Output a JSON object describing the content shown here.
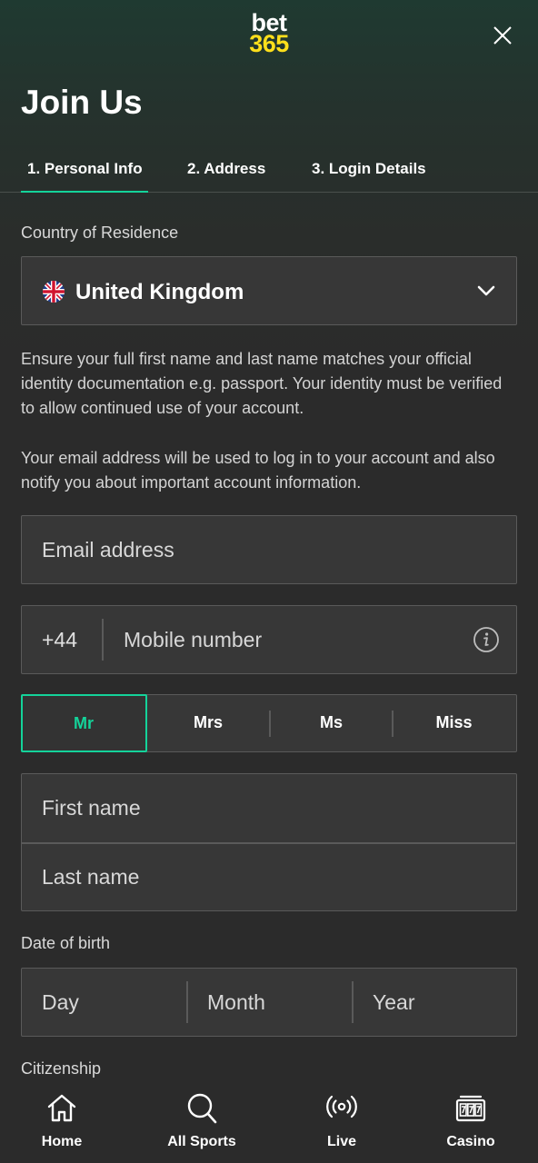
{
  "header": {
    "logo_line1": "bet",
    "logo_line2": "365",
    "title": "Join Us"
  },
  "tabs": [
    {
      "label": "1.  Personal Info",
      "active": true
    },
    {
      "label": "2.  Address",
      "active": false
    },
    {
      "label": "3.  Login Details",
      "active": false
    }
  ],
  "country": {
    "label": "Country of Residence",
    "value": "United Kingdom",
    "flag_icon": "uk-flag-icon"
  },
  "info": {
    "name_notice": "Ensure your full first name and last name matches your official identity documentation e.g. passport. Your identity must be verified to allow continued use of your account.",
    "email_notice": "Your email address will be used to log in to your account and also notify you about important account information."
  },
  "email": {
    "placeholder": "Email address"
  },
  "phone": {
    "prefix": "+44",
    "placeholder": "Mobile number"
  },
  "titles": {
    "options": [
      "Mr",
      "Mrs",
      "Ms",
      "Miss"
    ],
    "selected": "Mr"
  },
  "names": {
    "first_placeholder": "First name",
    "last_placeholder": "Last name"
  },
  "dob": {
    "label": "Date of birth",
    "day": "Day",
    "month": "Month",
    "year": "Year"
  },
  "citizenship": {
    "label": "Citizenship"
  },
  "bottom_nav": [
    {
      "label": "Home",
      "icon": "home-icon"
    },
    {
      "label": "All Sports",
      "icon": "search-icon"
    },
    {
      "label": "Live",
      "icon": "live-broadcast-icon"
    },
    {
      "label": "Casino",
      "icon": "slot-machine-icon"
    }
  ],
  "colors": {
    "accent": "#14d39a",
    "brand_yellow": "#ffdf1b",
    "background": "#2b2b2b"
  }
}
